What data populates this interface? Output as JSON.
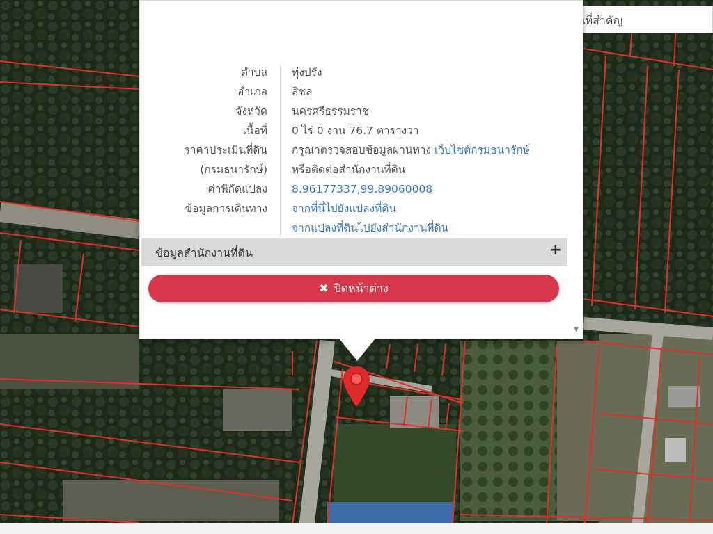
{
  "search": {
    "text": "ถานที่สำคัญ"
  },
  "popup": {
    "rows": [
      {
        "key": "ตำบล",
        "value": "ทุ่งปรัง"
      },
      {
        "key": "อำเภอ",
        "value": "สิชล"
      },
      {
        "key": "จังหวัด",
        "value": "นครศรีธรรมราช"
      },
      {
        "key": "เนื้อที่",
        "value": "0 ไร่ 0 งาน 76.7 ตารางวา"
      },
      {
        "key": "ราคาประเมินที่ดิน",
        "value": "กรุณาตรวจสอบข้อมูลผ่านทาง",
        "link": "เว็บไซต์กรมธนารักษ์"
      },
      {
        "key": "(กรมธนารักษ์)",
        "value": "หรือติดต่อสำนักงานที่ดิน"
      },
      {
        "key": "ค่าพิกัดแปลง",
        "link": "8.96177337,99.89060008"
      },
      {
        "key": "ข้อมูลการเดินทาง",
        "link": "จากที่นี่ไปยังแปลงที่ดิน"
      },
      {
        "key": "",
        "link": "จากแปลงที่ดินไปยังสำนักงานที่ดิน"
      }
    ],
    "accordion_label": "ข้อมูลสำนักงานที่ดิน",
    "close_label": "ปิดหน้าต่าง"
  },
  "colors": {
    "parcel_line": "#e0302e",
    "marker": "#e02a2a",
    "close_button": "#d9384a",
    "link": "#3a7bc8",
    "accordion": "#d9d9d9"
  },
  "icons": [
    "map-marker-icon",
    "plus-icon",
    "close-icon",
    "scroll-down-icon"
  ]
}
